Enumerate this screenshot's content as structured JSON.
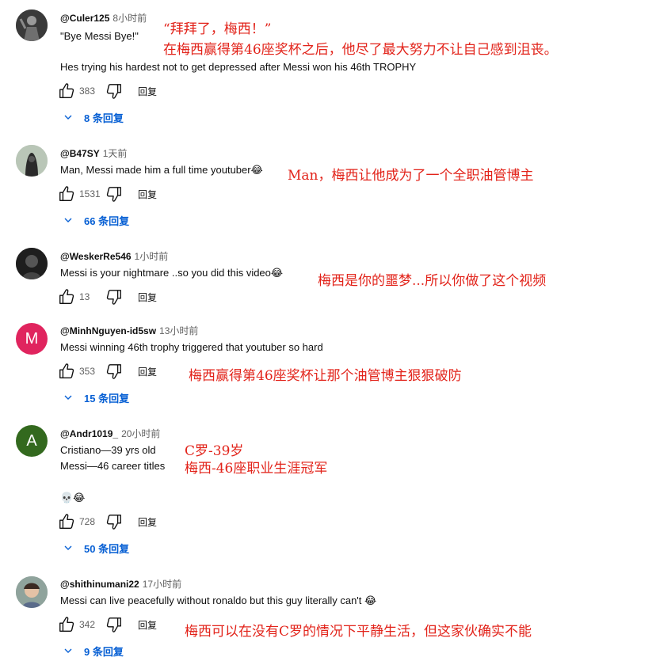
{
  "comments": [
    {
      "handle": "@Culer125",
      "time": "8小时前",
      "lines": [
        "\"Bye Messi Bye!\"",
        "Hes trying his hardest not to get depressed after Messi won his 46th TROPHY"
      ],
      "likes": "383",
      "reply_label": "回复",
      "replies": "8 条回复",
      "annotations": [
        "“拜拜了，梅西！”",
        "在梅西赢得第46座奖杯之后，他尽了最大努力不让自己感到沮丧。"
      ],
      "avatar_color": "#5a5a5a"
    },
    {
      "handle": "@B47SY",
      "time": "1天前",
      "lines": [
        "Man, Messi made him a full time youtuber😂"
      ],
      "likes": "1531",
      "reply_label": "回复",
      "replies": "66 条回复",
      "annotations": [
        "Man，梅西让他成为了一个全职油管博主"
      ],
      "avatar_color": "#9aa89a"
    },
    {
      "handle": "@WeskerRe546",
      "time": "1小时前",
      "lines": [
        "Messi is your nightmare ..so you did this video😂"
      ],
      "likes": "13",
      "reply_label": "回复",
      "annotations": [
        "梅西是你的噩梦...所以你做了这个视频"
      ],
      "avatar_color": "#2b2b2b"
    },
    {
      "handle": "@MinhNguyen-id5sw",
      "time": "13小时前",
      "lines": [
        "Messi winning 46th trophy triggered that youtuber so hard"
      ],
      "likes": "353",
      "reply_label": "回复",
      "replies": "15 条回复",
      "annotations": [
        "梅西赢得第46座奖杯让那个油管博主狠狠破防"
      ],
      "avatar_letter": "M",
      "avatar_color": "#e0245e"
    },
    {
      "handle": "@Andr1019_",
      "time": "20小时前",
      "lines": [
        "Cristiano—39 yrs old",
        "Messi—46 career titles",
        "💀😂"
      ],
      "likes": "728",
      "reply_label": "回复",
      "replies": "50 条回复",
      "annotations": [
        "C罗-39岁",
        "梅西-46座职业生涯冠军"
      ],
      "avatar_letter": "A",
      "avatar_color": "#33691e"
    },
    {
      "handle": "@shithinumani22",
      "time": "17小时前",
      "lines": [
        "Messi can live peacefully without ronaldo but this guy literally can't 😂"
      ],
      "likes": "342",
      "reply_label": "回复",
      "replies": "9 条回复",
      "annotations": [
        "梅西可以在没有C罗的情况下平静生活，但这家伙确实不能"
      ],
      "avatar_color": "#7c8f8a"
    }
  ],
  "colors": {
    "link_blue": "#065fd4",
    "annotation_red": "#e2231a"
  },
  "icons": [
    "thumb-up-icon",
    "thumb-down-icon",
    "chevron-down-icon"
  ]
}
